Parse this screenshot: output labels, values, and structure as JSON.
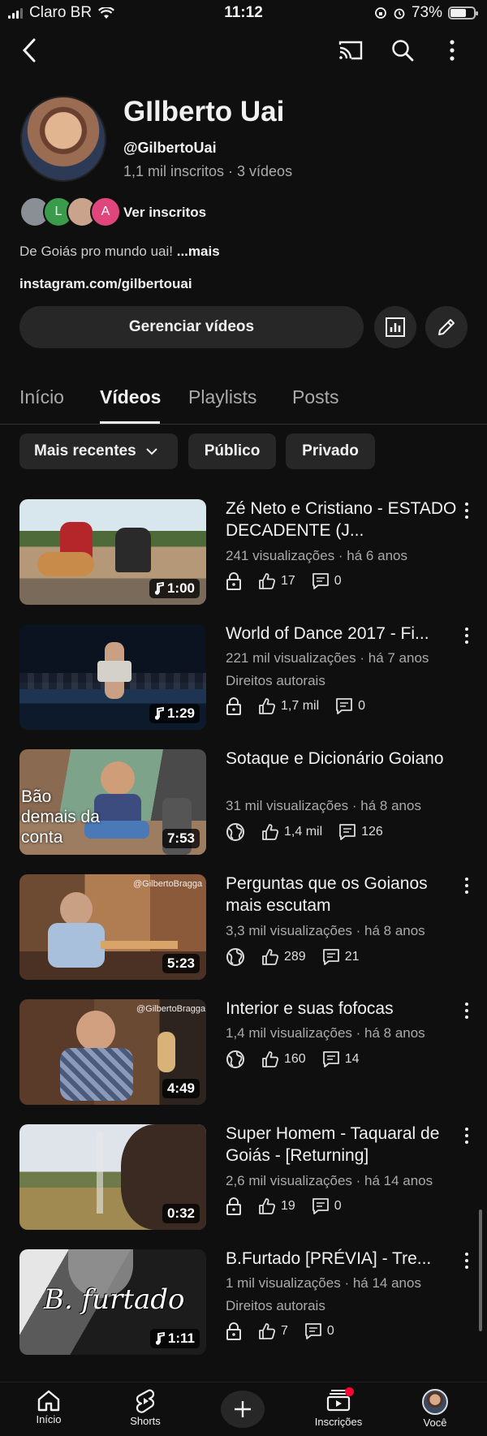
{
  "status_bar": {
    "carrier": "Claro BR",
    "time": "11:12",
    "battery": "73%",
    "battery_level": 0.73
  },
  "top_nav": {
    "back_icon": "chevron-left-icon",
    "cast_icon": "cast-icon",
    "search_icon": "search-icon",
    "more_icon": "more-vertical-icon"
  },
  "channel": {
    "name": "GIlberto Uai",
    "handle": "@GilbertoUai",
    "meta": "1,1 mil inscritos · 3 vídeos",
    "subscriber_avatars": [
      "",
      "L",
      "",
      "A"
    ],
    "subscriber_colors": [
      "#8a8f96",
      "#3a9b4a",
      "#c9a38b",
      "#e0457b"
    ],
    "ver_inscritos": "Ver inscritos",
    "description": "De Goiás pro mundo uai!",
    "more": "...mais",
    "link": "instagram.com/gilbertouai",
    "manage_button": "Gerenciar vídeos"
  },
  "tabs": [
    {
      "label": "Início",
      "active": false
    },
    {
      "label": "Vídeos",
      "active": true
    },
    {
      "label": "Playlists",
      "active": false
    },
    {
      "label": "Posts",
      "active": false
    }
  ],
  "chips": {
    "sort": "Mais recentes",
    "public": "Público",
    "private": "Privado"
  },
  "videos": [
    {
      "title": "Zé Neto e Cristiano - ESTADO DECADENTE (J...",
      "meta": "241 visualizações · há 6 anos",
      "extra": "",
      "duration": "1:00",
      "music": true,
      "visibility": "lock-icon",
      "likes": "17",
      "comments": "0"
    },
    {
      "title": "World of Dance 2017 - Fi...",
      "meta": "221 mil visualizações · há 7 anos",
      "extra": "Direitos autorais",
      "duration": "1:29",
      "music": true,
      "visibility": "lock-icon",
      "likes": "1,7 mil",
      "comments": "0"
    },
    {
      "title": "Sotaque e Dicionário Goiano",
      "meta": "31 mil visualizações · há 8 anos",
      "extra": "",
      "duration": "7:53",
      "music": false,
      "visibility": "globe-icon",
      "likes": "1,4 mil",
      "comments": "126",
      "thumb_text": "Bão demais da conta"
    },
    {
      "title": "Perguntas que os Goianos mais escutam",
      "meta": "3,3 mil visualizações · há 8 anos",
      "extra": "",
      "duration": "5:23",
      "music": false,
      "visibility": "globe-icon",
      "likes": "289",
      "comments": "21",
      "thumb_text": "@GilbertoBragga"
    },
    {
      "title": "Interior e suas fofocas",
      "meta": "1,4 mil visualizações · há 8 anos",
      "extra": "",
      "duration": "4:49",
      "music": false,
      "visibility": "globe-icon",
      "likes": "160",
      "comments": "14",
      "thumb_text": "@GilbertoBragga"
    },
    {
      "title": "Super Homem - Taquaral de Goiás - [Returning]",
      "meta": "2,6 mil visualizações · há 14 anos",
      "extra": "",
      "duration": "0:32",
      "music": false,
      "visibility": "lock-icon",
      "likes": "19",
      "comments": "0"
    },
    {
      "title": "B.Furtado [PRÉVIA] - Tre...",
      "meta": "1 mil visualizações · há 14 anos",
      "extra": "Direitos autorais",
      "duration": "1:11",
      "music": true,
      "visibility": "lock-icon",
      "likes": "7",
      "comments": "0",
      "thumb_text": "B. furtado"
    }
  ],
  "bottom_nav": [
    {
      "label": "Início",
      "icon": "home-icon"
    },
    {
      "label": "Shorts",
      "icon": "shorts-icon"
    },
    {
      "label": "",
      "icon": "plus-icon"
    },
    {
      "label": "Inscrições",
      "icon": "subscriptions-icon"
    },
    {
      "label": "Você",
      "icon": "avatar"
    }
  ]
}
